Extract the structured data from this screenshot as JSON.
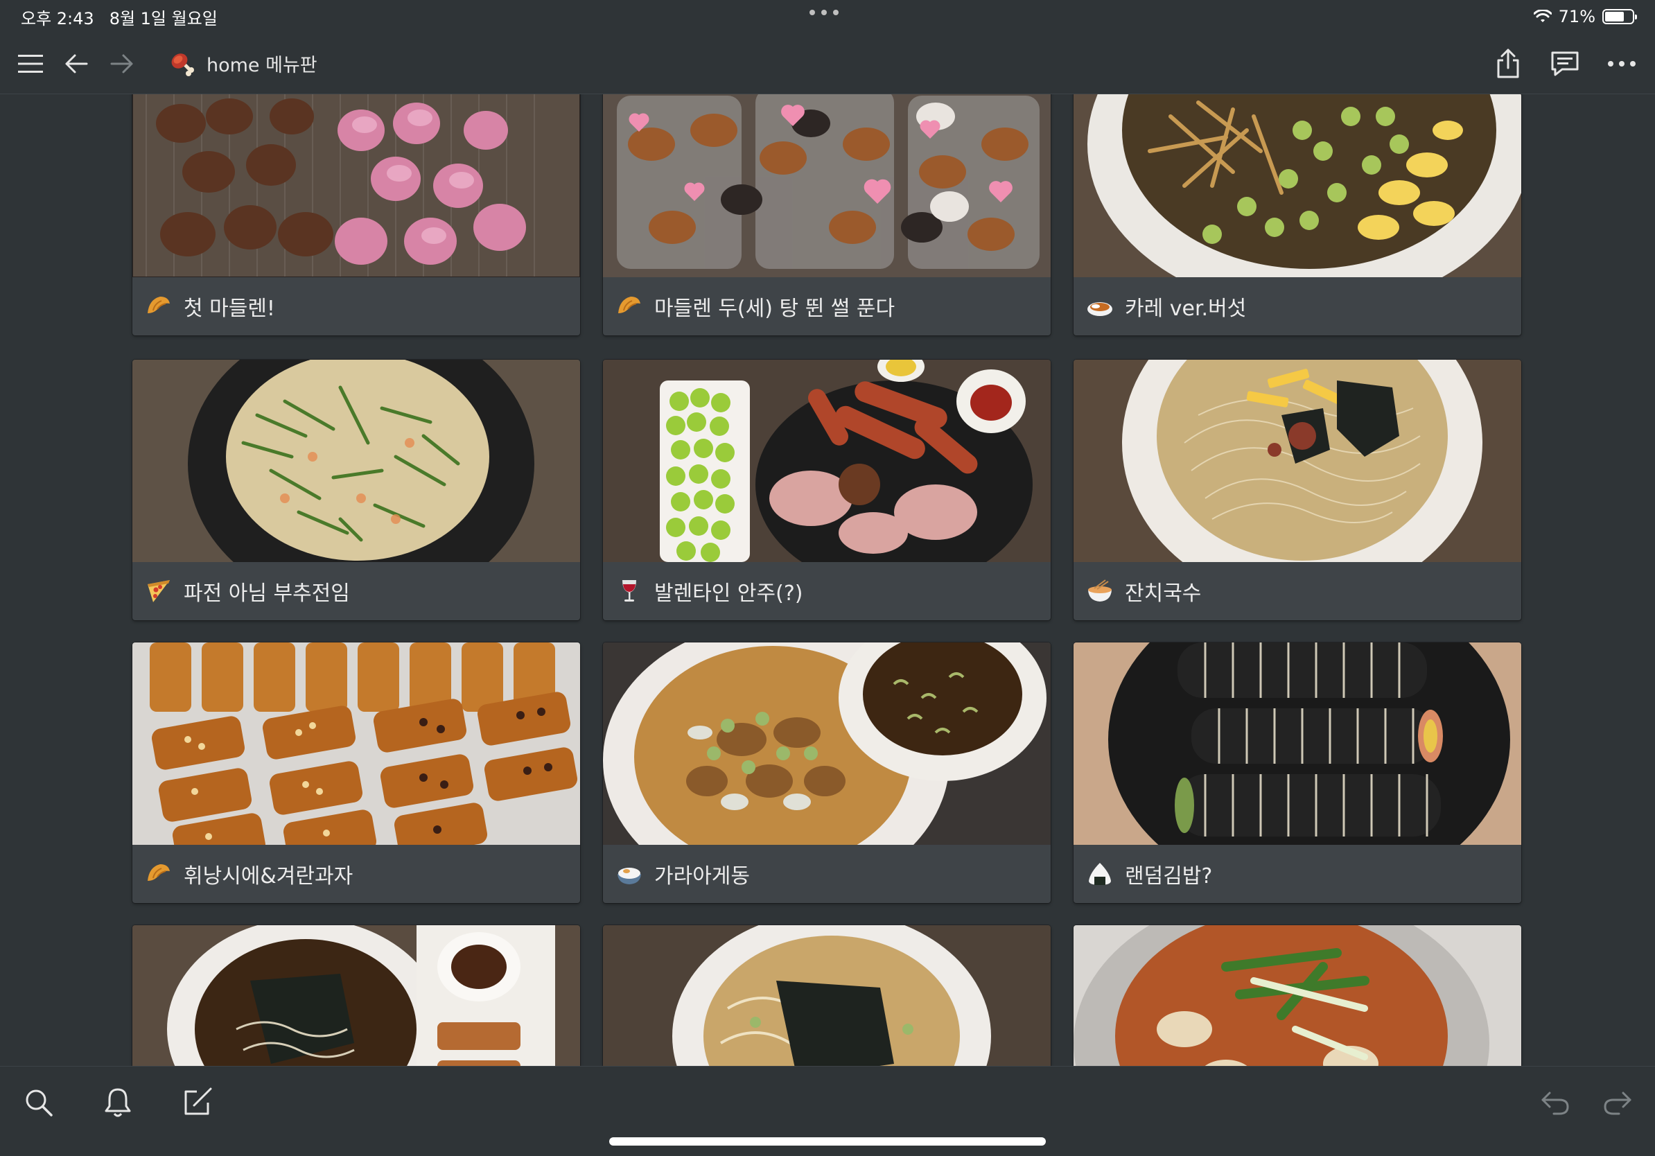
{
  "status_bar": {
    "time": "오후 2:43",
    "date": "8월 1일 월요일",
    "battery": "71%",
    "battery_level": 0.71
  },
  "nav": {
    "page_title": "home 메뉴판",
    "page_icon": "meat-on-bone-icon"
  },
  "gallery": {
    "cards": [
      {
        "title": "첫 마들렌!",
        "icon": "croissant-icon"
      },
      {
        "title": "마들렌 두(세) 탕 뛴 썰 푼다",
        "icon": "croissant-icon"
      },
      {
        "title": "카레 ver.버섯",
        "icon": "curry-rice-icon"
      },
      {
        "title": "파전 아님 부추전임",
        "icon": "pizza-icon"
      },
      {
        "title": "발렌타인 안주(?)",
        "icon": "wine-glass-icon"
      },
      {
        "title": "잔치국수",
        "icon": "noodle-bowl-icon"
      },
      {
        "title": "휘낭시에&겨란과자",
        "icon": "croissant-icon"
      },
      {
        "title": "가라아게동",
        "icon": "rice-bowl-icon"
      },
      {
        "title": "랜덤김밥?",
        "icon": "rice-ball-icon"
      },
      {
        "title": "",
        "icon": ""
      },
      {
        "title": "",
        "icon": ""
      },
      {
        "title": "",
        "icon": ""
      }
    ]
  },
  "colors": {
    "background": "#2f3437",
    "card": "#3f4448",
    "text": "#e6e6e6"
  }
}
